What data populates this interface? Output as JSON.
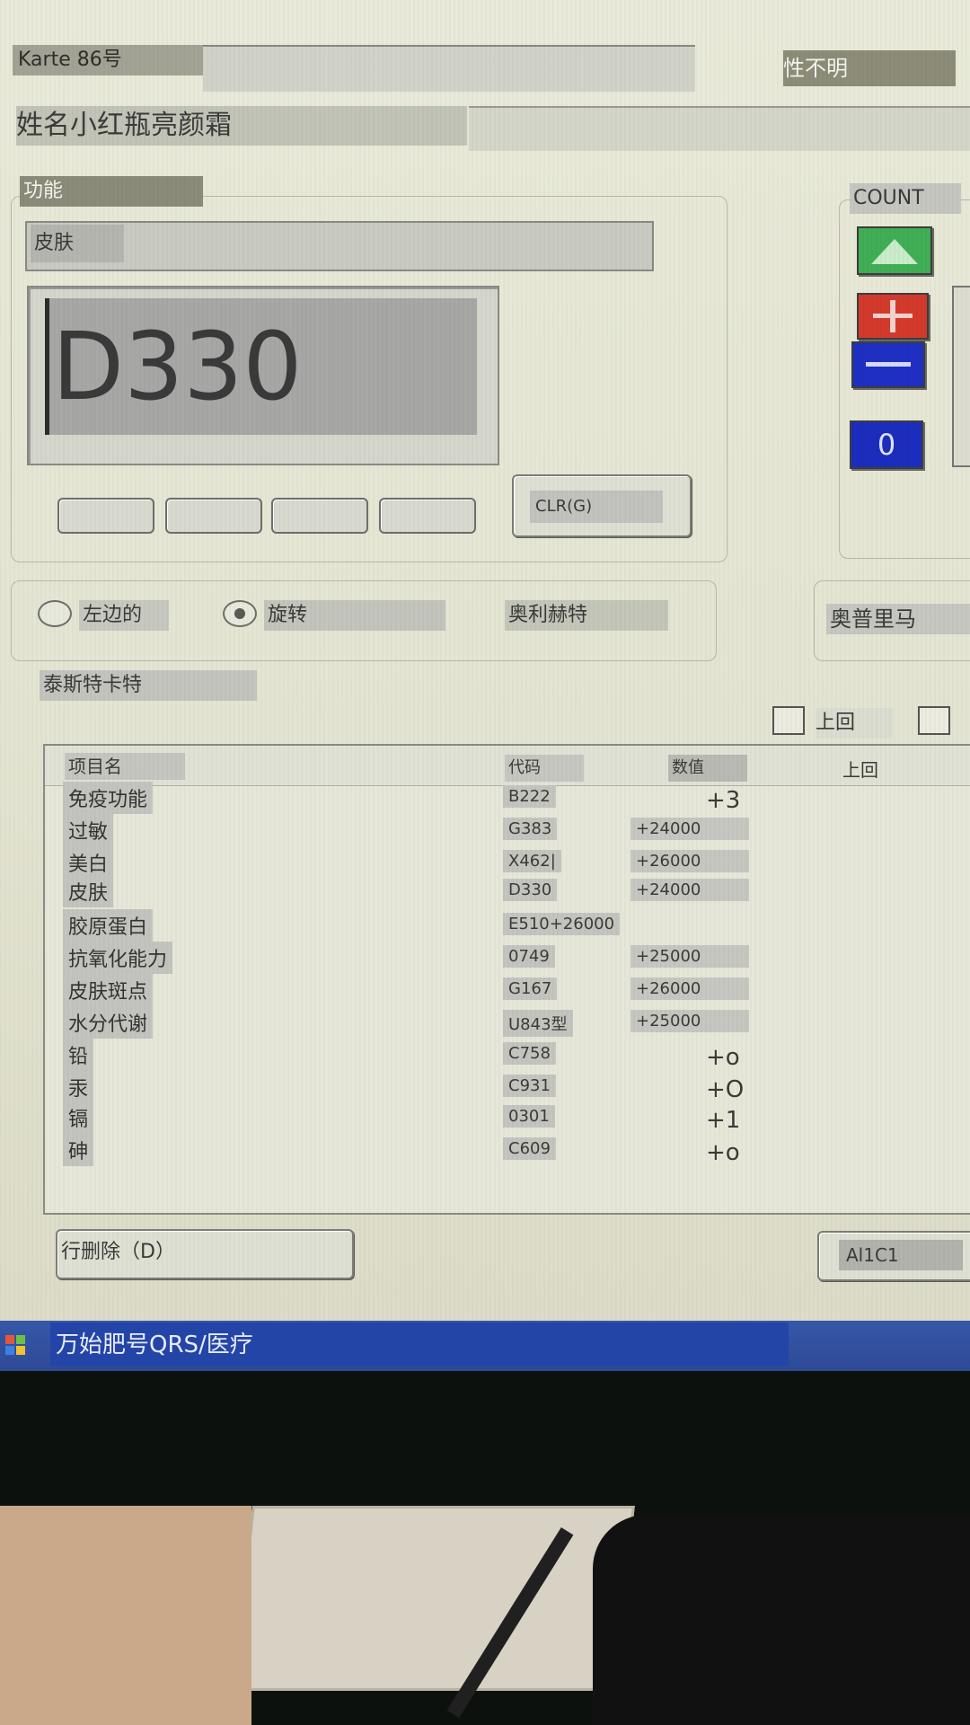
{
  "header": {
    "karte_label": "Karte 86号",
    "gender_label": "性不明",
    "name_label": "姓名小红瓶亮颜霜"
  },
  "function_group": {
    "title": "功能",
    "category_field": "皮肤",
    "code_display": "D330",
    "clr_button": "CLR(G)"
  },
  "count_group": {
    "title": "COUNT",
    "up_icon": "triangle-up-icon",
    "plus_icon": "plus-icon",
    "minus_icon": "minus-icon",
    "zero_label": "0"
  },
  "options": {
    "radio_left": "左边的",
    "radio_rotate": "旋转",
    "olihert": "奥利赫特",
    "optima": "奥普里马",
    "tester": "泰斯特卡特",
    "checkbox_prev": "上回"
  },
  "table": {
    "headers": {
      "item": "项目名",
      "code": "代码",
      "value": "数值",
      "prev": "上回"
    },
    "rows": [
      {
        "item": "免疫功能",
        "code": "B222",
        "value": "+3"
      },
      {
        "item": "过敏",
        "code": "G383",
        "value": "+24000"
      },
      {
        "item": "美白",
        "code": "X462|",
        "value": "+26000"
      },
      {
        "item": "皮肤",
        "code": "D330",
        "value": "+24000"
      },
      {
        "item": "胶原蛋白",
        "code": "E510+26000",
        "value": ""
      },
      {
        "item": "抗氧化能力",
        "code": "0749",
        "value": "+25000"
      },
      {
        "item": "皮肤斑点",
        "code": "G167",
        "value": "+26000"
      },
      {
        "item": "水分代谢",
        "code": "U843型",
        "value": "+25000"
      },
      {
        "item": "铅",
        "code": "C758",
        "value": "+o"
      },
      {
        "item": "汞",
        "code": "C931",
        "value": "+O"
      },
      {
        "item": "镉",
        "code": "0301",
        "value": "+1"
      },
      {
        "item": "砷",
        "code": "C609",
        "value": "+o"
      }
    ]
  },
  "bottom": {
    "delete_row": "行删除（D）",
    "right_button": "Al1C1"
  },
  "taskbar": {
    "title": "万始肥号QRS/医疗"
  },
  "colors": {
    "up_button": "#3fae55",
    "plus_button": "#d33a2c",
    "minus_button": "#1f2fc4",
    "zero_button": "#1b2dbd",
    "taskbar": "#2f4d9b"
  }
}
